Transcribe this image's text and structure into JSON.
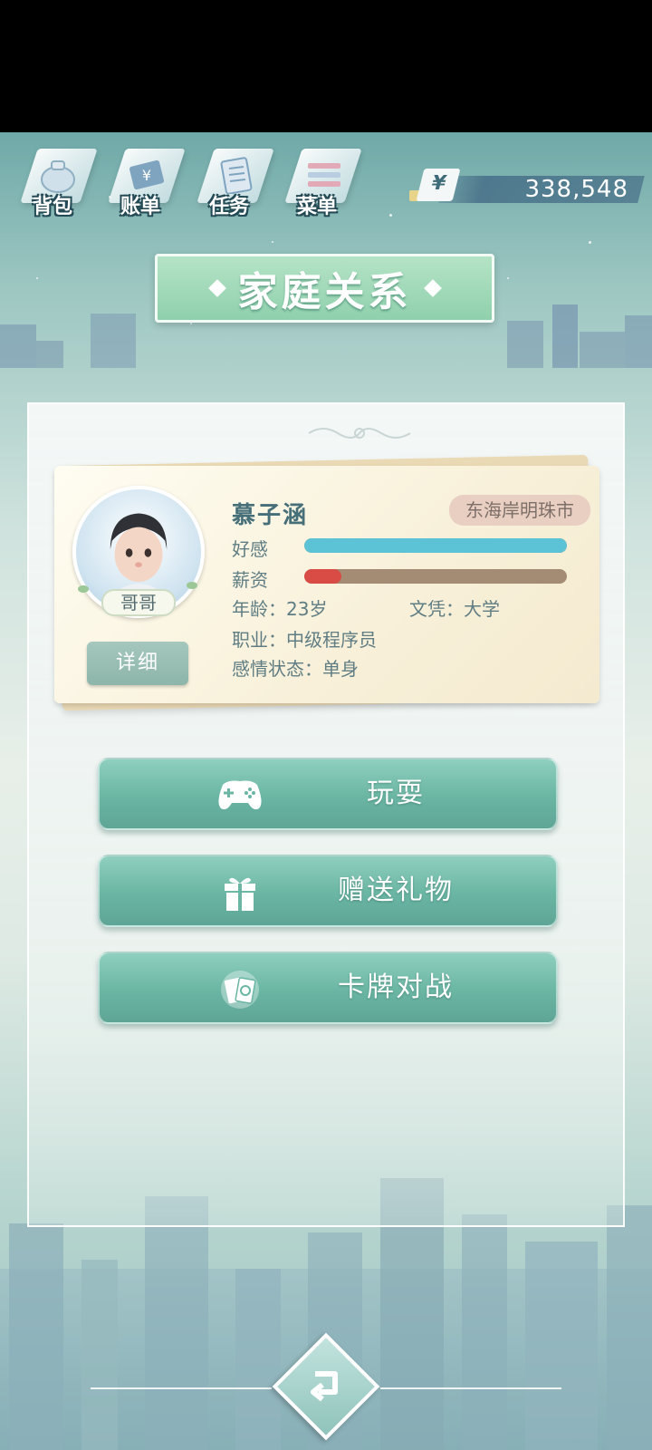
{
  "nav": {
    "items": [
      {
        "label": "背包",
        "icon": "bag-icon"
      },
      {
        "label": "账单",
        "icon": "bill-icon"
      },
      {
        "label": "任务",
        "icon": "task-list-icon"
      },
      {
        "label": "菜单",
        "icon": "menu-icon"
      }
    ]
  },
  "currency": {
    "symbol": "¥",
    "value": "338,548"
  },
  "title": "家庭关系",
  "character": {
    "name": "慕子涵",
    "relation": "哥哥",
    "city": "东海岸明珠市",
    "favor_label": "好感",
    "favor_level": 1.0,
    "salary_label": "薪资",
    "salary_level": 0.14,
    "age": "年龄：23岁",
    "education": "文凭：大学",
    "job": "职业：中级程序员",
    "relationship_status": "感情状态：单身",
    "detail_button": "详细"
  },
  "actions": [
    {
      "label": "玩耍",
      "icon": "gamepad-icon"
    },
    {
      "label": "赠送礼物",
      "icon": "gift-icon"
    },
    {
      "label": "卡牌对战",
      "icon": "cards-icon"
    }
  ],
  "colors": {
    "favor_bar": "#5cc3d6",
    "salary_fill": "#d94b45",
    "bar_track": "#a48b74",
    "action_button": "#6ab5a3",
    "title_banner": "#9fd8b8"
  }
}
